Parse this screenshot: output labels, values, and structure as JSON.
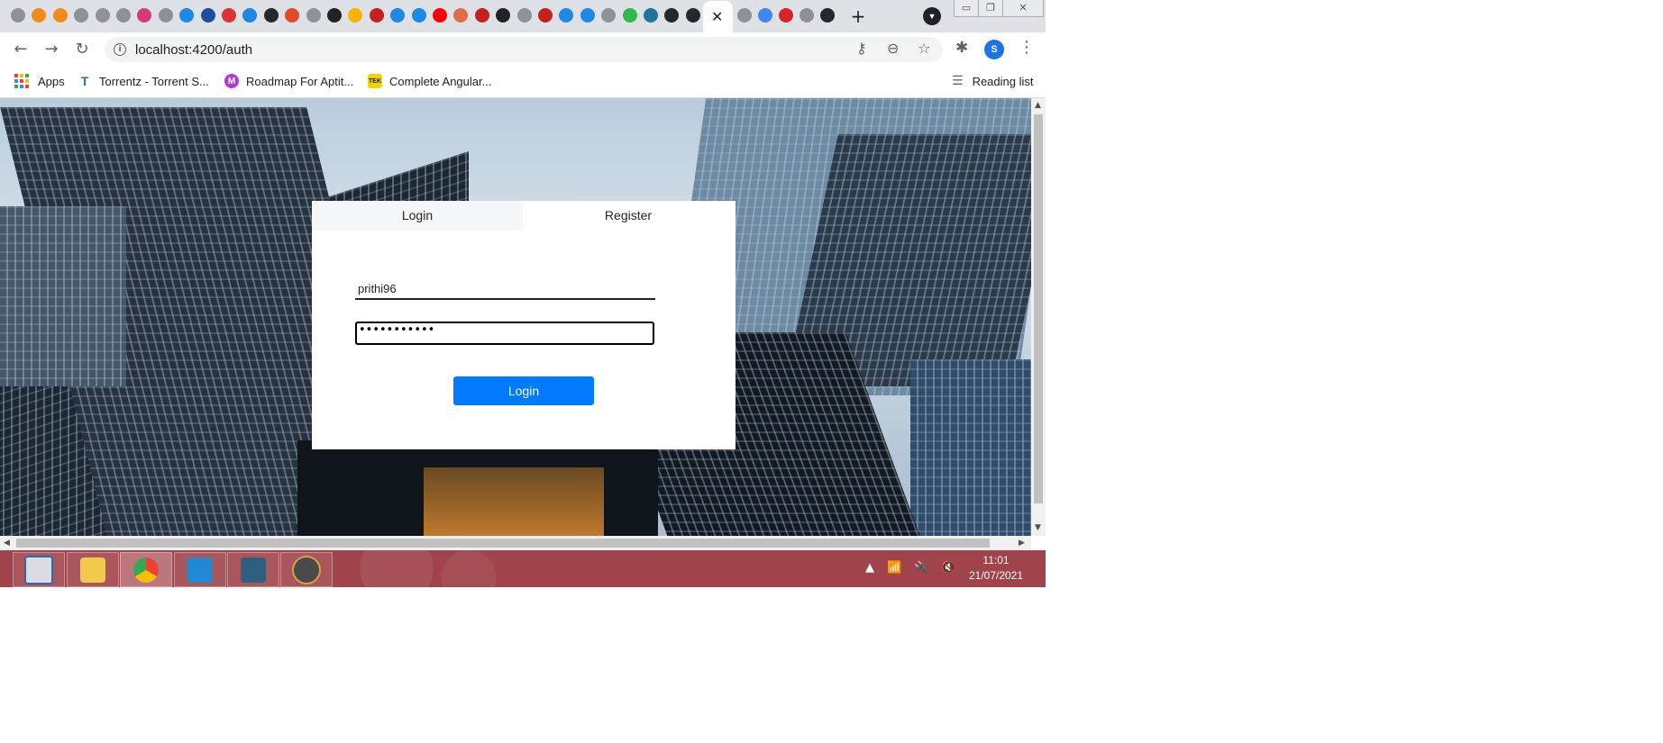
{
  "browser": {
    "active_tab_close": "✕",
    "new_tab": "+",
    "url": "localhost:4200/auth",
    "profile_initial": "S",
    "bookmarks": [
      {
        "label": "Apps",
        "icon": "apps-grid-icon"
      },
      {
        "label": "Torrentz - Torrent S...",
        "icon": "torrentz-icon"
      },
      {
        "label": "Roadmap For Aptit...",
        "icon": "roadmap-icon"
      },
      {
        "label": "Complete Angular...",
        "icon": "tek-icon"
      }
    ],
    "reading_list": "Reading list",
    "bookmark_badges": {
      "roadmap": "M",
      "tek": "TEK",
      "torrentz": "T"
    }
  },
  "auth": {
    "tabs": [
      "Login",
      "Register"
    ],
    "username_value": "prithi96",
    "password_mask": "•••••••••••",
    "submit_label": "Login"
  },
  "taskbar": {
    "time": "11:01",
    "date": "21/07/2021"
  },
  "colors": {
    "primary_button": "#007bff",
    "taskbar": "#a0434b",
    "profile": "#1a73e8"
  }
}
